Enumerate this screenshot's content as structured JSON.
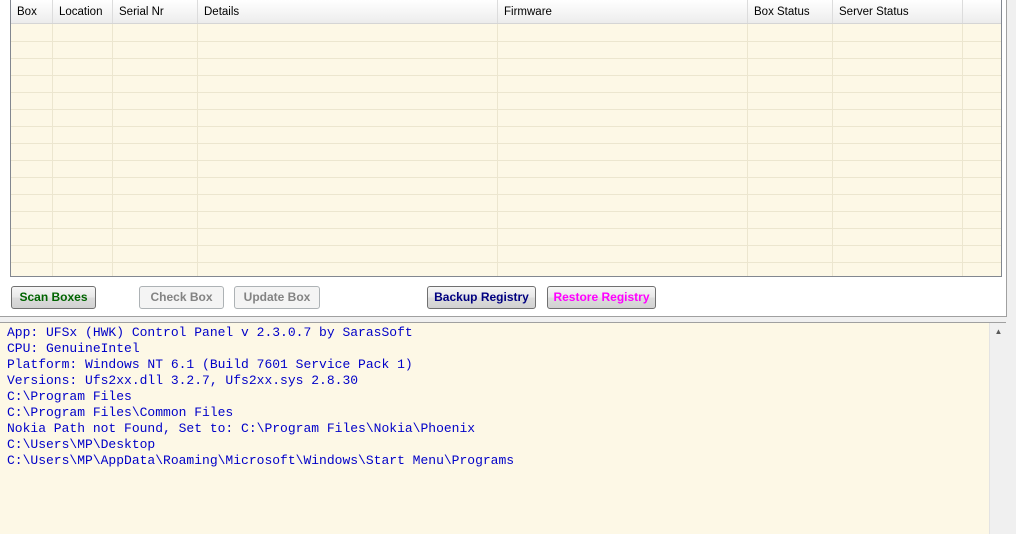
{
  "table": {
    "columns": [
      "Box",
      "Location",
      "Serial Nr",
      "Details",
      "Firmware",
      "Box Status",
      "Server Status"
    ],
    "rows": []
  },
  "buttons": {
    "scan": "Scan Boxes",
    "check": "Check Box",
    "update": "Update Box",
    "backup": "Backup Registry",
    "restore": "Restore Registry"
  },
  "log": {
    "lines": [
      "App: UFSx (HWK) Control Panel v 2.3.0.7 by SarasSoft",
      "CPU: GenuineIntel",
      "Platform: Windows NT 6.1 (Build 7601 Service Pack 1)",
      "Versions: Ufs2xx.dll 3.2.7, Ufs2xx.sys 2.8.30",
      "C:\\Program Files",
      "C:\\Program Files\\Common Files",
      "Nokia Path not Found, Set to: C:\\Program Files\\Nokia\\Phoenix",
      "C:\\Users\\MP\\Desktop",
      "C:\\Users\\MP\\AppData\\Roaming\\Microsoft\\Windows\\Start Menu\\Programs"
    ]
  },
  "scrollbar": {
    "up_icon": "scroll-up-arrow-icon"
  },
  "colors": {
    "grid_background": "#fdf8e6",
    "log_text": "#0000c8",
    "scan_button_text": "#006400",
    "backup_button_text": "#000080",
    "restore_button_text": "#ff00ff"
  }
}
